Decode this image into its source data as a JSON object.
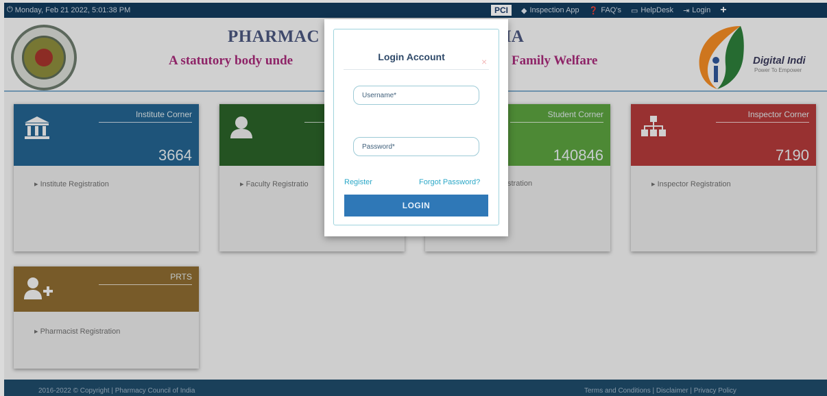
{
  "topbar": {
    "datetime": "Monday, Feb 21 2022, 5:01:38 PM",
    "pci_badge": "PCI",
    "items": [
      {
        "label": "Inspection App",
        "icon": "diamond-icon"
      },
      {
        "label": "FAQ's",
        "icon": "question-circle-icon"
      },
      {
        "label": "HelpDesk",
        "icon": "monitor-icon"
      },
      {
        "label": "Login",
        "icon": "sign-in-icon"
      }
    ],
    "plus_icon": "plus-icon"
  },
  "header": {
    "title_left": "PHARMAC",
    "title_right": "DIA",
    "subtitle_left": "A statutory body unde",
    "subtitle_right": "Family Welfare",
    "logo_text": "Digital Indi",
    "logo_tagline": "Power To Empower"
  },
  "cards": [
    {
      "title": "Institute Corner",
      "count": "3664",
      "link": "Institute Registration",
      "icon": "institution-icon",
      "color": "#23628e"
    },
    {
      "title": "",
      "count": "",
      "link": "Faculty Registratio",
      "icon": "user-icon",
      "color": "#2b6128"
    },
    {
      "title": "Student Corner",
      "count": "140846",
      "link": "stration",
      "icon": "",
      "color": "#5aa03e"
    },
    {
      "title": "Inspector Corner",
      "count": "7190",
      "link": "Inspector Registration",
      "icon": "sitemap-icon",
      "color": "#b23a3a"
    },
    {
      "title": "PRTS",
      "count": "",
      "link": "Pharmacist Registration",
      "icon": "user-plus-icon",
      "color": "#8c6a30"
    }
  ],
  "footer": {
    "left": "2016-2022 © Copyright | Pharmacy Council of India",
    "right": "Terms and Conditions | Disclaimer | Privacy Policy"
  },
  "modal": {
    "title": "Login Account",
    "close": "×",
    "username_placeholder": "Username*",
    "password_placeholder": "Password*",
    "register": "Register",
    "forgot": "Forgot Password?",
    "login_button": "LOGIN"
  }
}
